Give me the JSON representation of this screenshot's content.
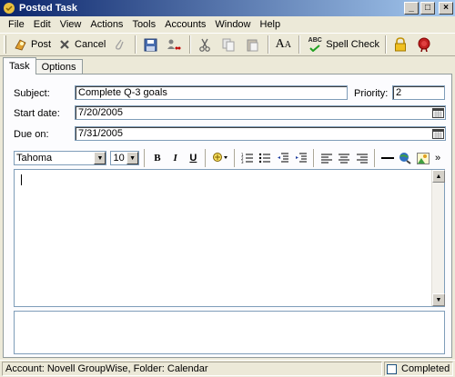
{
  "window": {
    "title": "Posted Task",
    "minimize": "_",
    "maximize": "□",
    "close": "×"
  },
  "menu": [
    "File",
    "Edit",
    "View",
    "Actions",
    "Tools",
    "Accounts",
    "Window",
    "Help"
  ],
  "toolbar": {
    "post_label": "Post",
    "cancel_label": "Cancel",
    "spell_check_label": "Spell Check",
    "spell_icon_text": "ABC",
    "font_icon_text": "A"
  },
  "tabs": [
    "Task",
    "Options"
  ],
  "form": {
    "subject_label": "Subject:",
    "subject_value": "Complete Q-3 goals",
    "priority_label": "Priority:",
    "priority_value": "2",
    "start_label": "Start date:",
    "start_value": "7/20/2005",
    "due_label": "Due on:",
    "due_value": "7/31/2005"
  },
  "format": {
    "font": "Tahoma",
    "size": "10",
    "bold": "B",
    "italic": "I",
    "underline": "U",
    "more": "»"
  },
  "status": {
    "text": "Account: Novell GroupWise,  Folder: Calendar",
    "completed_label": "Completed"
  },
  "colors": {
    "titlebar_start": "#0a246a",
    "titlebar_end": "#a6caf0",
    "chrome": "#ece9d8"
  }
}
